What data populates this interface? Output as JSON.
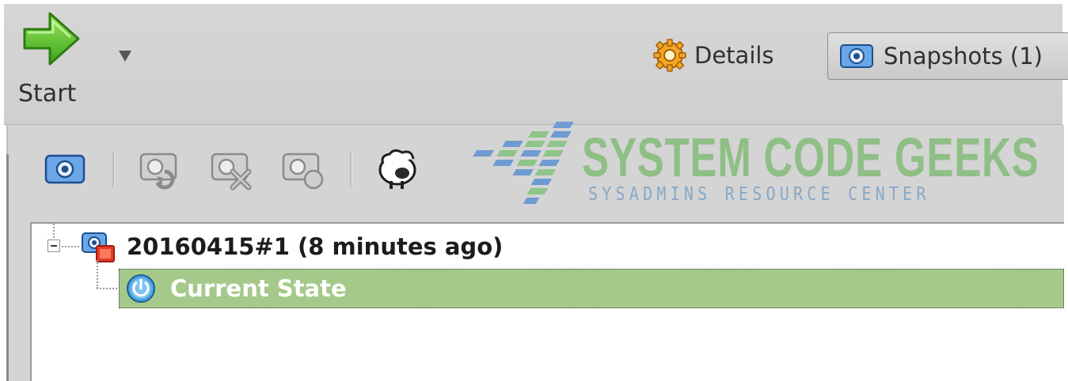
{
  "toolbar": {
    "start_label": "Start",
    "details_label": "Details",
    "snapshots_label": "Snapshots (1)"
  },
  "watermark": {
    "title": "SYSTEM CODE GEEKS",
    "subtitle": "SYSADMINS RESOURCE CENTER"
  },
  "snapshot_toolbar": {
    "buttons": [
      {
        "icon": "take-snapshot-icon",
        "enabled": true
      },
      {
        "icon": "restore-snapshot-icon",
        "enabled": false
      },
      {
        "icon": "delete-snapshot-icon",
        "enabled": false
      },
      {
        "icon": "snapshot-details-icon",
        "enabled": false
      },
      {
        "icon": "clone-sheep-icon",
        "enabled": true
      }
    ]
  },
  "tree": {
    "snapshot_label": "20160415#1 (8 minutes ago)",
    "current_state_label": "Current State",
    "selected_color": "#a5c98b"
  },
  "colors": {
    "toolbar_bg": "#d3d3d3",
    "start_arrow_green": "#5cc42a",
    "selection_green": "#a5c98b"
  }
}
